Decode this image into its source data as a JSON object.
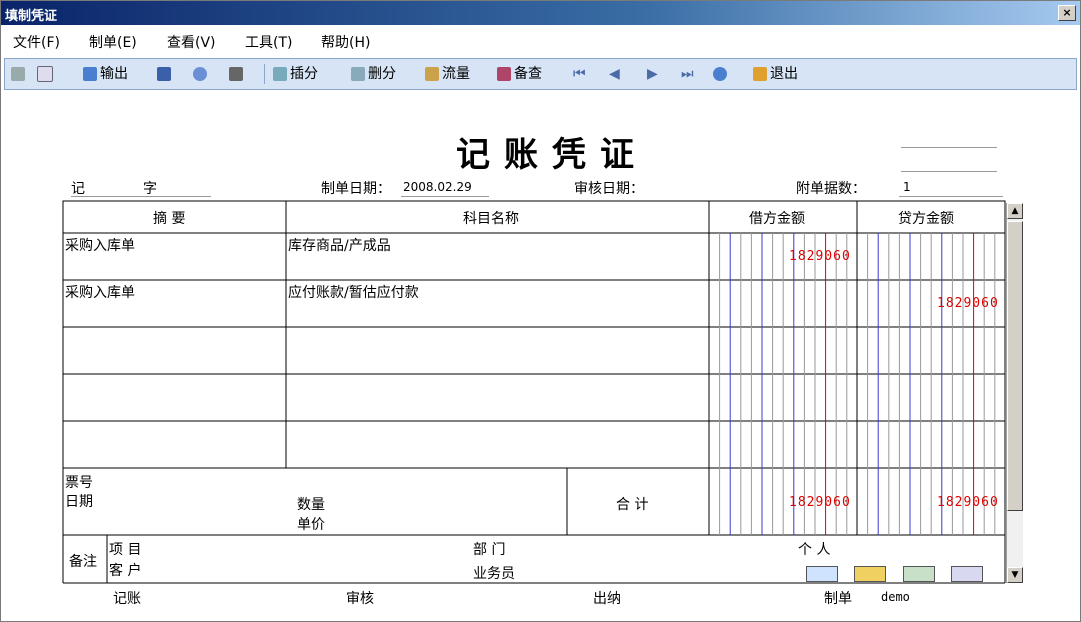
{
  "window": {
    "title": "填制凭证",
    "close": "×"
  },
  "menu": [
    "文件(F)",
    "制单(E)",
    "查看(V)",
    "工具(T)",
    "帮助(H)"
  ],
  "toolbar": {
    "output": "输出",
    "insert": "插分",
    "delete": "删分",
    "flow": "流量",
    "check": "备查",
    "exit": "退出"
  },
  "voucher": {
    "title": "记账凭证",
    "type_label": "记",
    "zi_label": "字",
    "date_label": "制单日期：",
    "date_value": "2008.02.29",
    "audit_label": "审核日期：",
    "attach_label": "附单据数：",
    "attach_value": "1"
  },
  "table": {
    "headers": {
      "summary": "摘 要",
      "account": "科目名称",
      "debit": "借方金额",
      "credit": "贷方金额"
    },
    "rows": [
      {
        "summary": "采购入库单",
        "account": "库存商品/产成品",
        "debit": "1829060",
        "credit": ""
      },
      {
        "summary": "采购入库单",
        "account": "应付账款/暂估应付款",
        "debit": "",
        "credit": "1829060"
      },
      {
        "summary": "",
        "account": "",
        "debit": "",
        "credit": ""
      },
      {
        "summary": "",
        "account": "",
        "debit": "",
        "credit": ""
      },
      {
        "summary": "",
        "account": "",
        "debit": "",
        "credit": ""
      }
    ],
    "ticket_label": "票号",
    "date_label": "日期",
    "qty_label": "数量",
    "price_label": "单价",
    "total_label": "合 计",
    "total_debit": "1829060",
    "total_credit": "1829060"
  },
  "notes": {
    "label": "备注",
    "project": "项  目",
    "customer": "客  户",
    "dept": "部  门",
    "salesman": "业务员",
    "person": "个  人"
  },
  "footer": {
    "bookkeeping": "记账",
    "audit": "审核",
    "cashier": "出纳",
    "maker_label": "制单",
    "maker_value": "demo"
  },
  "colors": {
    "debit_line_blue": "#3a3ad0",
    "red": "#e00000",
    "toolbar_bg": "#d6e4f5"
  }
}
